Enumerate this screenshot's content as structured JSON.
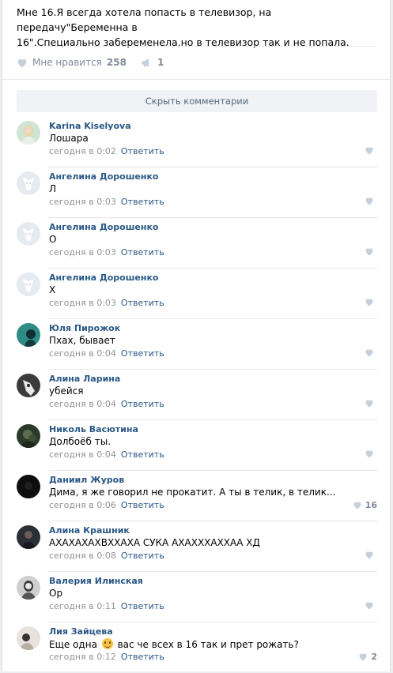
{
  "post": {
    "text_line1": "Мне 16.Я всегда хотела попасть в телевизор, на передачу\"Беременна в",
    "text_line2": "16\".Специально забеременела,но в телевизор так и не попала.",
    "like_label": "Мне нравится",
    "like_count": "258",
    "share_count": "1"
  },
  "hide_comments_label": "Скрыть комментарии",
  "comments": [
    {
      "author": "Karina Kiselyova",
      "text": "Лошара",
      "time": "сегодня в 0:02",
      "reply": "Ответить",
      "likes": "",
      "avatar": "photo-blond"
    },
    {
      "author": "Ангелина Дорошенко",
      "text": "Л",
      "time": "сегодня в 0:03",
      "reply": "Ответить",
      "likes": "",
      "avatar": "default-dog"
    },
    {
      "author": "Ангелина Дорошенко",
      "text": "О",
      "time": "сегодня в 0:03",
      "reply": "Ответить",
      "likes": "",
      "avatar": "default-dog"
    },
    {
      "author": "Ангелина Дорошенко",
      "text": "Х",
      "time": "сегодня в 0:03",
      "reply": "Ответить",
      "likes": "",
      "avatar": "default-dog"
    },
    {
      "author": "Юля Пирожок",
      "text": "Пхах, бывает",
      "time": "сегодня в 0:04",
      "reply": "Ответить",
      "likes": "",
      "avatar": "photo-teal"
    },
    {
      "author": "Алина Ларина",
      "text": "убейся",
      "time": "сегодня в 0:04",
      "reply": "Ответить",
      "likes": "",
      "avatar": "photo-bw"
    },
    {
      "author": "Николь Васютина",
      "text": "Долбоёб ты.",
      "time": "сегодня в 0:04",
      "reply": "Ответить",
      "likes": "",
      "avatar": "photo-dark-green"
    },
    {
      "author": "Даниил Журов",
      "text": "Дима, я же говорил не прокатит. А ты в телик, в телик...",
      "time": "сегодня в 0:06",
      "reply": "Ответить",
      "likes": "16",
      "avatar": "photo-black"
    },
    {
      "author": "Алина Крашник",
      "text": "АХАХАХАХВХХАХА СУКА АХАХХХАХХАА ХД",
      "time": "сегодня в 0:08",
      "reply": "Ответить",
      "likes": "",
      "avatar": "photo-dark"
    },
    {
      "author": "Валерия Илинская",
      "text": "Ор",
      "time": "сегодня в 0:11",
      "reply": "Ответить",
      "likes": "",
      "avatar": "photo-grey"
    },
    {
      "author": "Лия Зайцева",
      "text_before": "Еще одна",
      "text_after": "вас че всех в 16 так и прет рожать?",
      "time": "сегодня в 0:12",
      "reply": "Ответить",
      "likes": "2",
      "avatar": "photo-light"
    }
  ],
  "icons": {
    "heart": "heart-icon",
    "share": "megaphone-icon",
    "emoji": "laughing-smiley-icon"
  },
  "colors": {
    "link": "#2a5885",
    "muted": "#939393",
    "like_grey": "#c5d0db",
    "background": "#edeef0"
  }
}
